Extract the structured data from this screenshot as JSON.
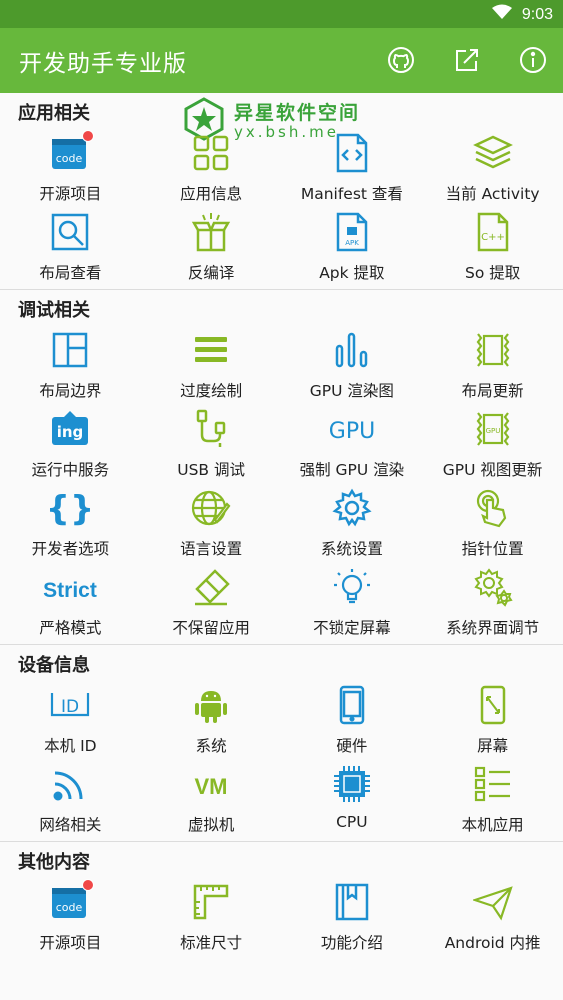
{
  "status_bar": {
    "time": "9:03"
  },
  "app_bar": {
    "title": "开发助手专业版"
  },
  "watermark": {
    "name": "异星软件空间",
    "url": "yx.bsh.me"
  },
  "sections": {
    "app": {
      "title": "应用相关",
      "items": [
        {
          "label": "开源项目",
          "icon": "code-icon"
        },
        {
          "label": "应用信息",
          "icon": "grid-icon"
        },
        {
          "label": "Manifest 查看",
          "icon": "xml-file-icon"
        },
        {
          "label": "当前 Activity",
          "icon": "layers-icon"
        },
        {
          "label": "布局查看",
          "icon": "magnifier-icon"
        },
        {
          "label": "反编译",
          "icon": "box-icon"
        },
        {
          "label": "Apk 提取",
          "icon": "apk-file-icon"
        },
        {
          "label": "So 提取",
          "icon": "cpp-file-icon"
        }
      ]
    },
    "debug": {
      "title": "调试相关",
      "items": [
        {
          "label": "布局边界",
          "icon": "layout-bounds-icon"
        },
        {
          "label": "过度绘制",
          "icon": "hamburger-icon"
        },
        {
          "label": "GPU 渲染图",
          "icon": "bars-icon"
        },
        {
          "label": "布局更新",
          "icon": "layout-update-icon"
        },
        {
          "label": "运行中服务",
          "icon": "ing-icon"
        },
        {
          "label": "USB 调试",
          "icon": "usb-icon"
        },
        {
          "label": "强制 GPU 渲染",
          "icon": "gpu-text-icon"
        },
        {
          "label": "GPU 视图更新",
          "icon": "gpu-view-icon"
        },
        {
          "label": "开发者选项",
          "icon": "braces-icon"
        },
        {
          "label": "语言设置",
          "icon": "globe-icon"
        },
        {
          "label": "系统设置",
          "icon": "gear-icon"
        },
        {
          "label": "指针位置",
          "icon": "pointer-icon"
        },
        {
          "label": "严格模式",
          "icon": "strict-icon"
        },
        {
          "label": "不保留应用",
          "icon": "eraser-icon"
        },
        {
          "label": "不锁定屏幕",
          "icon": "bulb-icon"
        },
        {
          "label": "系统界面调节",
          "icon": "gears-icon"
        }
      ]
    },
    "device": {
      "title": "设备信息",
      "items": [
        {
          "label": "本机 ID",
          "icon": "id-icon"
        },
        {
          "label": "系统",
          "icon": "android-icon"
        },
        {
          "label": "硬件",
          "icon": "phone-icon"
        },
        {
          "label": "屏幕",
          "icon": "screen-icon"
        },
        {
          "label": "网络相关",
          "icon": "wifi-icon"
        },
        {
          "label": "虚拟机",
          "icon": "vm-icon"
        },
        {
          "label": "CPU",
          "icon": "cpu-icon"
        },
        {
          "label": "本机应用",
          "icon": "list-icon"
        }
      ]
    },
    "other": {
      "title": "其他内容",
      "items": [
        {
          "label": "开源项目",
          "icon": "code-icon"
        },
        {
          "label": "标准尺寸",
          "icon": "ruler-icon"
        },
        {
          "label": "功能介绍",
          "icon": "book-icon"
        },
        {
          "label": "Android 内推",
          "icon": "send-icon"
        }
      ]
    }
  },
  "icon_texts": {
    "code": "code",
    "ing": "ing",
    "gpu": "GPU",
    "strict": "Strict",
    "vm": "VM",
    "id": "ID",
    "apk": "APK",
    "cpp": "C++"
  },
  "colors": {
    "status_bar": "#4d9a2c",
    "app_bar": "#67b83c",
    "blue": "#1d8fd0",
    "green": "#88b825",
    "badge": "#f04848"
  }
}
